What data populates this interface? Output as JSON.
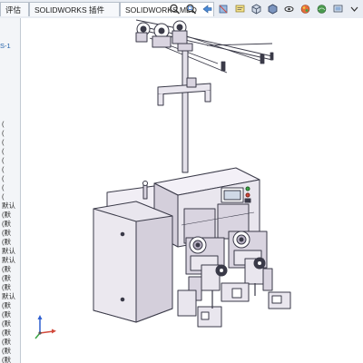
{
  "tabs": [
    {
      "label": "评估",
      "active": false
    },
    {
      "label": "SOLIDWORKS 插件",
      "active": false
    },
    {
      "label": "SOLIDWORKS MBD",
      "active": true
    }
  ],
  "view_toolbar": {
    "icons": [
      "zoom-to-fit-icon",
      "zoom-area-icon",
      "previous-view-icon",
      "section-view-icon",
      "dynamic-annotation-icon",
      "view-orientation-icon",
      "display-style-icon",
      "hide-show-icon",
      "edit-appearance-icon",
      "scene-icon",
      "view-settings-icon"
    ]
  },
  "feature_tree": {
    "header": "S-1",
    "items": [
      "(",
      "(",
      "(",
      "(",
      "(",
      "(",
      "(",
      "(",
      "(",
      "默认",
      "(默",
      "(默",
      "(默",
      "(默",
      "默认",
      "默认",
      "(默",
      "(默",
      "(默",
      "默认",
      "(默",
      "(默",
      "(默",
      "(默",
      "(默",
      "(默",
      "(默",
      "(默"
    ]
  },
  "colors": {
    "machine_fill": "#e9e6ee",
    "machine_dark": "#3a3a48",
    "panel_fill": "#d9d4e0",
    "accent_green": "#3aa645",
    "accent_red": "#d24a3c"
  }
}
